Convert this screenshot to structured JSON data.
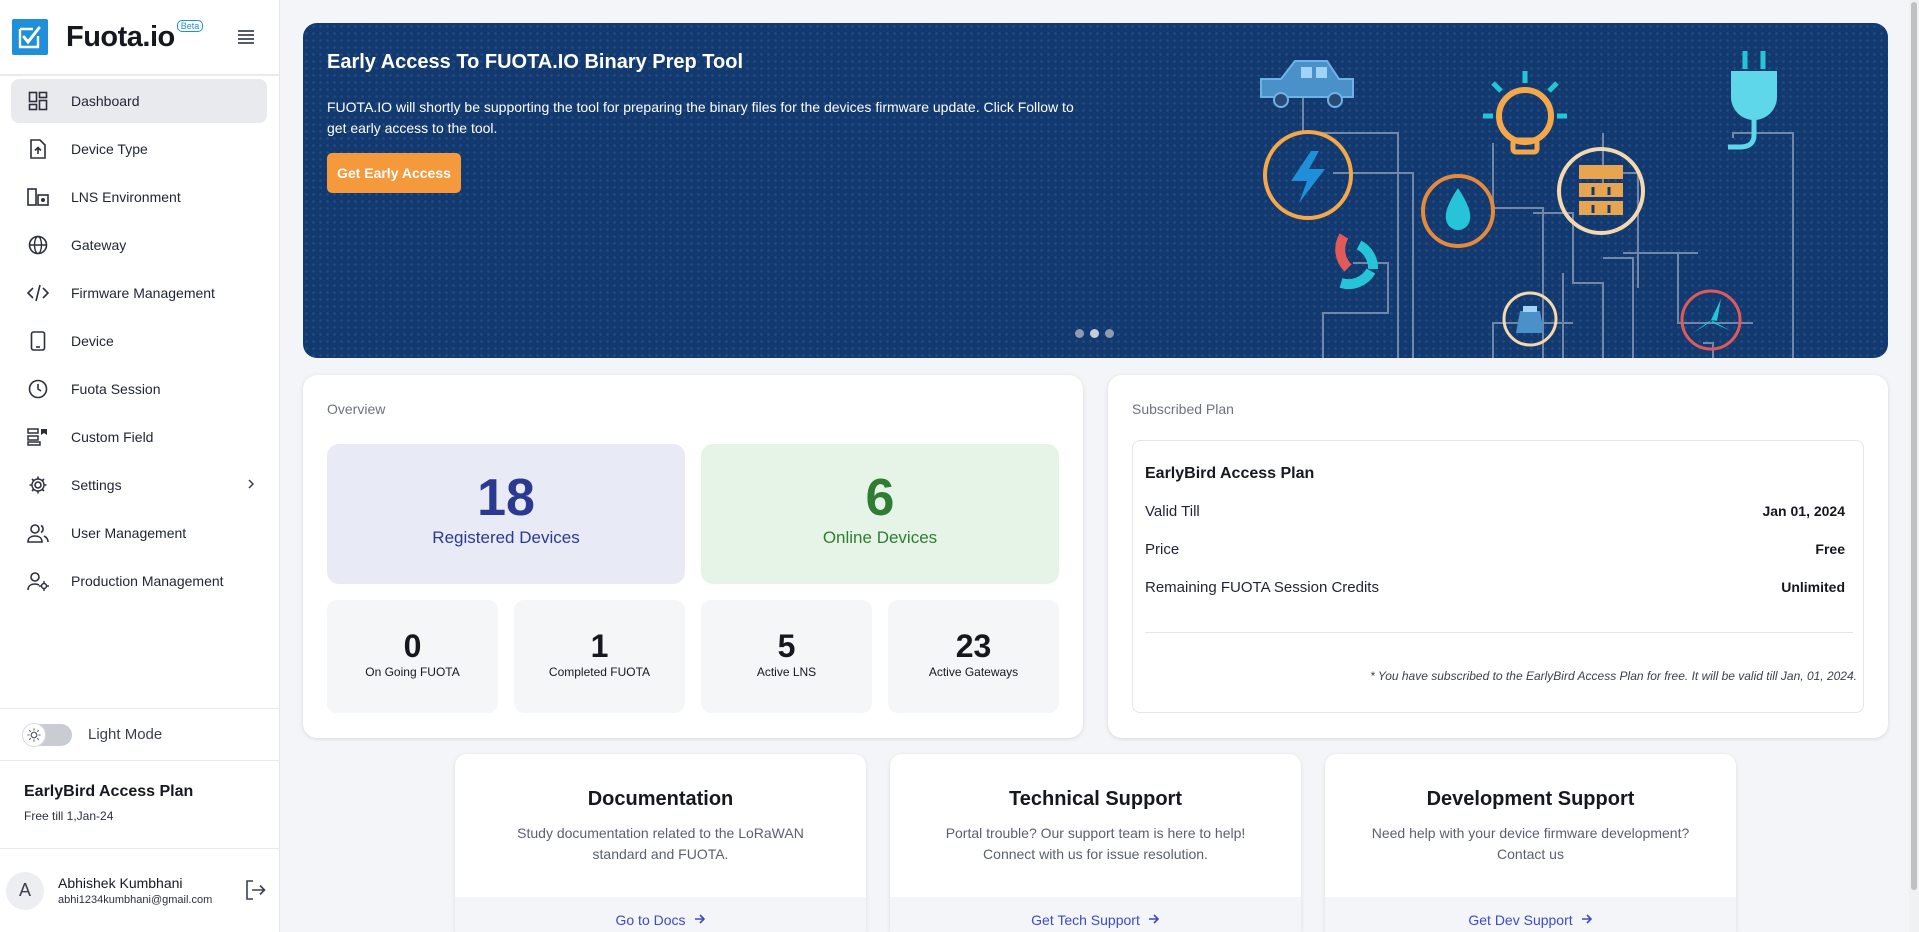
{
  "brand": {
    "name": "Fuota.io",
    "badge": "Beta"
  },
  "sidebar": {
    "items": [
      {
        "label": "Dashboard",
        "icon": "dashboard-icon"
      },
      {
        "label": "Device Type",
        "icon": "file-upload-icon"
      },
      {
        "label": "LNS Environment",
        "icon": "lns-icon"
      },
      {
        "label": "Gateway",
        "icon": "globe-icon"
      },
      {
        "label": "Firmware Management",
        "icon": "code-icon"
      },
      {
        "label": "Device",
        "icon": "device-icon"
      },
      {
        "label": "Fuota Session",
        "icon": "clock-icon"
      },
      {
        "label": "Custom Field",
        "icon": "custom-field-icon"
      },
      {
        "label": "Settings",
        "icon": "gear-icon"
      },
      {
        "label": "User Management",
        "icon": "users-icon"
      },
      {
        "label": "Production Management",
        "icon": "production-icon"
      }
    ],
    "mode_label": "Light Mode",
    "plan": {
      "title": "EarlyBird Access Plan",
      "subtitle": "Free till 1,Jan-24"
    },
    "user": {
      "initial": "A",
      "name": "Abhishek Kumbhani",
      "email": "abhi1234kumbhani@gmail.com"
    }
  },
  "banner": {
    "title": "Early Access To FUOTA.IO Binary Prep Tool",
    "text": "FUOTA.IO will shortly be supporting the tool for preparing the binary files for the devices firmware update. Click Follow to get early access to the tool.",
    "button": "Get Early Access",
    "slides": 3,
    "active_slide": 1
  },
  "overview": {
    "label": "Overview",
    "registered": {
      "value": "18",
      "label": "Registered Devices"
    },
    "online": {
      "value": "6",
      "label": "Online Devices"
    },
    "stats": [
      {
        "value": "0",
        "label": "On Going FUOTA"
      },
      {
        "value": "1",
        "label": "Completed FUOTA"
      },
      {
        "value": "5",
        "label": "Active LNS"
      },
      {
        "value": "23",
        "label": "Active Gateways"
      }
    ]
  },
  "subscribed": {
    "label": "Subscribed Plan",
    "plan_name": "EarlyBird Access Plan",
    "rows": [
      {
        "label": "Valid Till",
        "value": "Jan 01, 2024"
      },
      {
        "label": "Price",
        "value": "Free"
      },
      {
        "label": "Remaining FUOTA Session Credits",
        "value": "Unlimited"
      }
    ],
    "note": "* You have subscribed to the EarlyBird Access Plan for free. It will be valid till Jan, 01, 2024."
  },
  "support": [
    {
      "title": "Documentation",
      "desc": "Study documentation related to the LoRaWAN standard and FUOTA.",
      "link": "Go to Docs"
    },
    {
      "title": "Technical Support",
      "desc": "Portal trouble? Our support team is here to help! Connect with us for issue resolution.",
      "link": "Get Tech Support"
    },
    {
      "title": "Development Support",
      "desc": "Need help with your device firmware development? Contact us",
      "link": "Get Dev Support"
    }
  ],
  "colors": {
    "accent": "#1e8fd8",
    "banner_bg": "#123a70",
    "cta": "#f49a3c",
    "registered_bg": "#e8eaf6",
    "registered_text": "#2b3990",
    "online_bg": "#e6f4e8",
    "online_text": "#2e7d32",
    "link": "#3d4bc7"
  }
}
